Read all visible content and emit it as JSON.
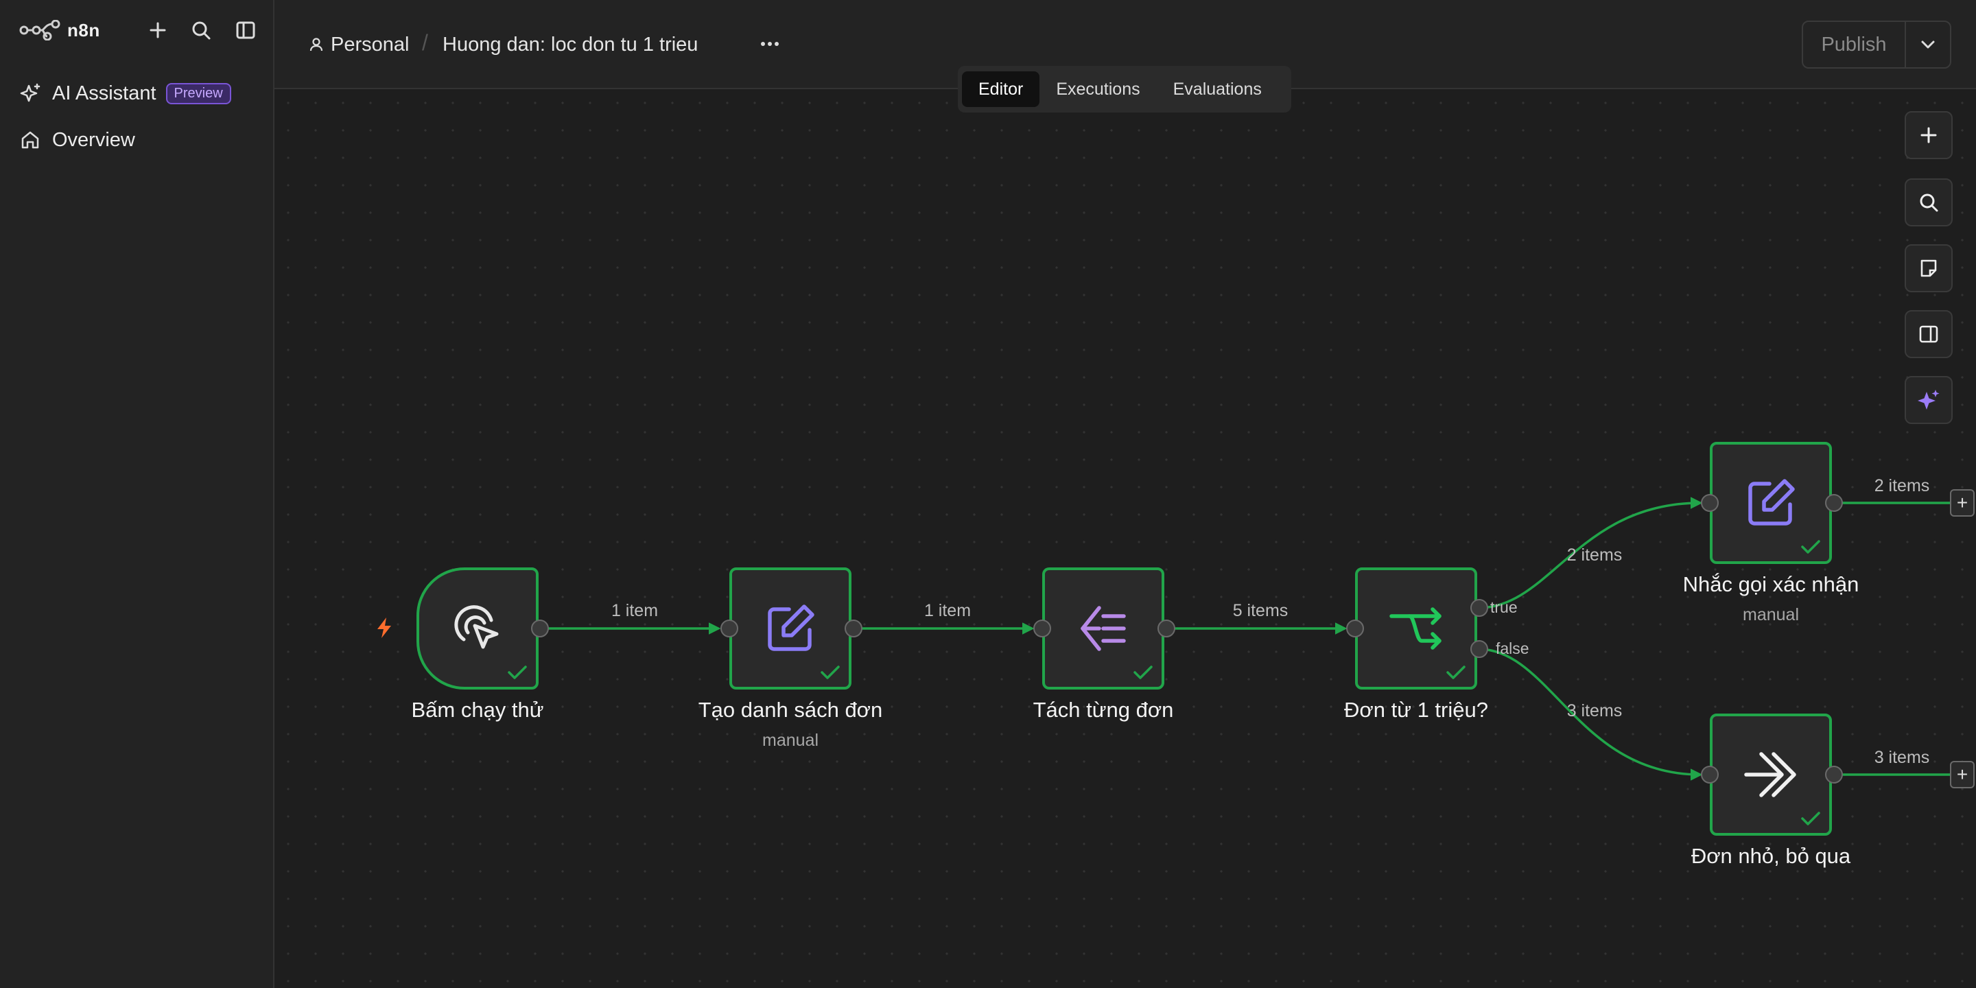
{
  "app": {
    "brand": "n8n"
  },
  "sidebar": {
    "items": [
      {
        "label": "AI Assistant",
        "badge": "Preview"
      },
      {
        "label": "Overview"
      }
    ]
  },
  "header": {
    "project": "Personal",
    "workflow_name": "Huong dan: loc don tu 1 trieu",
    "publish_label": "Publish"
  },
  "tabs": [
    "Editor",
    "Executions",
    "Evaluations"
  ],
  "active_tab": "Editor",
  "nodes": {
    "trigger": {
      "title": "Bấm chạy thử"
    },
    "create": {
      "title": "Tạo danh sách đơn",
      "subtitle": "manual"
    },
    "split": {
      "title": "Tách từng đơn"
    },
    "if": {
      "title": "Đơn từ 1 triệu?",
      "true_label": "true",
      "false_label": "false"
    },
    "remind": {
      "title": "Nhắc gọi xác nhận",
      "subtitle": "manual"
    },
    "noop": {
      "title": "Đơn nhỏ, bỏ qua"
    }
  },
  "edges": {
    "e1": "1 item",
    "e2": "1 item",
    "e3": "5 items",
    "e_true": "2 items",
    "e_false": "3 items",
    "e_remind_out": "2 items",
    "e_noop_out": "3 items"
  },
  "colors": {
    "success": "#21a54a",
    "trigger_bolt": "#ff6d2d",
    "accent": "#8b7cf6"
  }
}
